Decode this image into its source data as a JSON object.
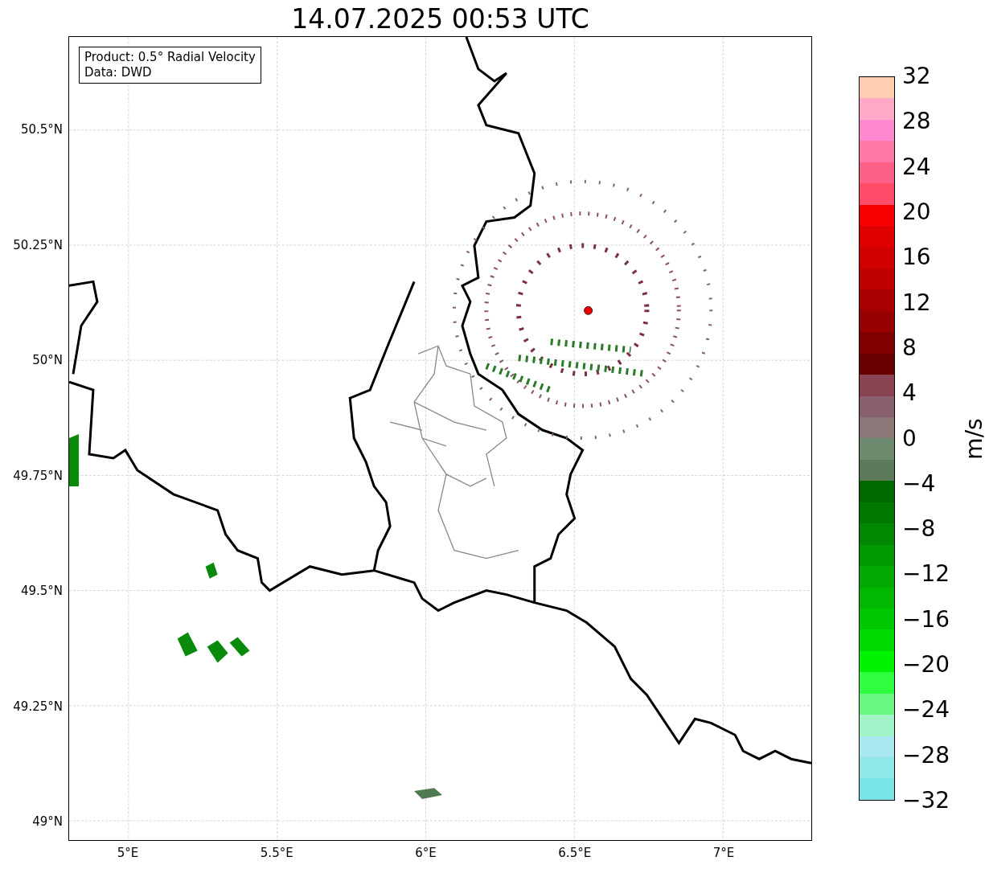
{
  "title": "14.07.2025 00:53 UTC",
  "legend": [
    "Product: 0.5° Radial Velocity",
    "Data: DWD"
  ],
  "axes": {
    "yticks": [
      "50.5°N",
      "50.25°N",
      "50°N",
      "49.75°N",
      "49.5°N",
      "49.25°N",
      "49°N"
    ],
    "xticks": [
      "5°E",
      "5.5°E",
      "6°E",
      "6.5°E",
      "7°E"
    ]
  },
  "colorbar": {
    "ticks": [
      "32",
      "28",
      "24",
      "20",
      "16",
      "12",
      "8",
      "4",
      "0",
      "−4",
      "−8",
      "−12",
      "−16",
      "−20",
      "−24",
      "−28",
      "−32"
    ],
    "label": "m/s",
    "bands": [
      {
        "color": "#ffcdb0"
      },
      {
        "color": "#ffa8c8"
      },
      {
        "color": "#ff88d0"
      },
      {
        "color": "#ff78a8"
      },
      {
        "color": "#ff6088"
      },
      {
        "color": "#ff4a68"
      },
      {
        "color": "#f80000"
      },
      {
        "color": "#e00000"
      },
      {
        "color": "#d00000"
      },
      {
        "color": "#c00000"
      },
      {
        "color": "#a80000"
      },
      {
        "color": "#980000"
      },
      {
        "color": "#800000"
      },
      {
        "color": "#680000"
      },
      {
        "color": "#884450"
      },
      {
        "color": "#886070"
      },
      {
        "color": "#8a7878"
      },
      {
        "color": "#6e8a6e"
      },
      {
        "color": "#5a7a5a"
      },
      {
        "color": "#006800"
      },
      {
        "color": "#007800"
      },
      {
        "color": "#008800"
      },
      {
        "color": "#009800"
      },
      {
        "color": "#00aa00"
      },
      {
        "color": "#00b800"
      },
      {
        "color": "#00c800"
      },
      {
        "color": "#00dc00"
      },
      {
        "color": "#00f400"
      },
      {
        "color": "#30ff40"
      },
      {
        "color": "#68f880"
      },
      {
        "color": "#a0f4c8"
      },
      {
        "color": "#a8e8ee"
      },
      {
        "color": "#90e8ea"
      },
      {
        "color": "#78e4e8"
      }
    ]
  }
}
